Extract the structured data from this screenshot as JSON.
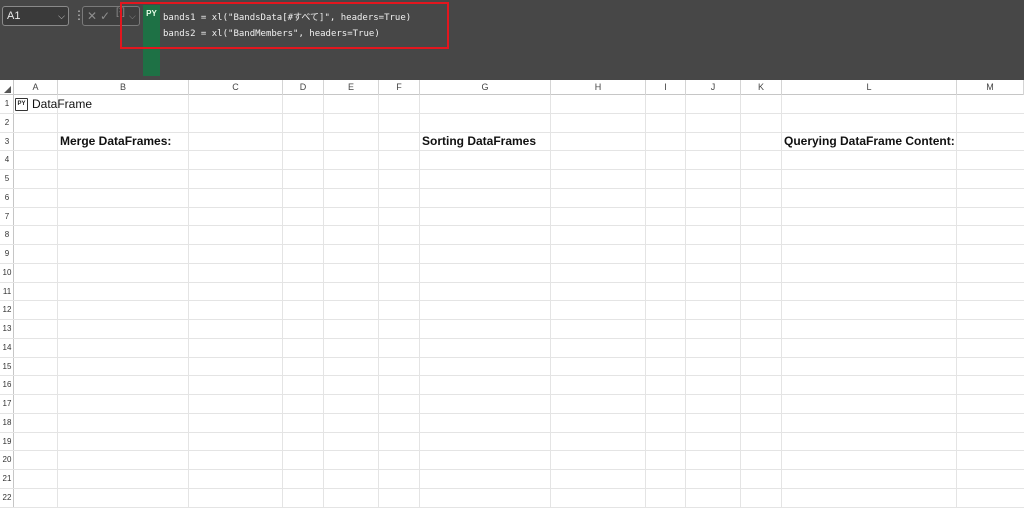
{
  "formula_bar": {
    "name_box": "A1",
    "py_label": "PY",
    "code_lines": [
      "bands1 = xl(\"BandsData[#すべて]\", headers=True)",
      "bands2 = xl(\"BandMembers\", headers=True)"
    ]
  },
  "columns": [
    "A",
    "B",
    "C",
    "D",
    "E",
    "F",
    "G",
    "H",
    "I",
    "J",
    "K",
    "L",
    "M"
  ],
  "rows": [
    "1",
    "2",
    "3",
    "4",
    "5",
    "6",
    "7",
    "8",
    "9",
    "10",
    "11",
    "12",
    "13",
    "14",
    "15",
    "16",
    "17",
    "18",
    "19",
    "20",
    "21",
    "22"
  ],
  "cells": {
    "a1_badge": "PY",
    "a1_value": "DataFrame",
    "b3": "Merge DataFrames:",
    "g3": "Sorting DataFrames",
    "l3": "Querying DataFrame Content:"
  },
  "colors": {
    "formula_bar_bg": "#474747",
    "python_green": "#1e7145",
    "highlight_red": "#e3161e"
  }
}
